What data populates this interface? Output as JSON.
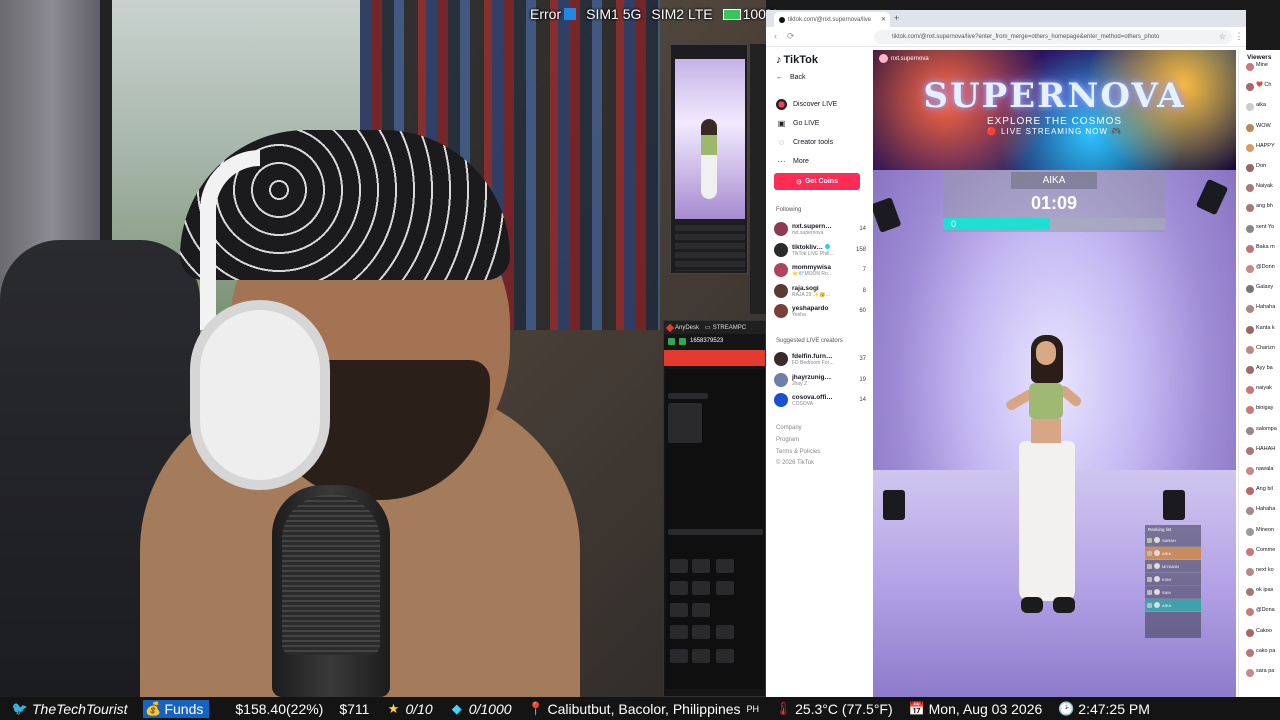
{
  "status_overlay": {
    "error": "Error",
    "sim1": "SIM1 5G",
    "sim2": "SIM2 LTE",
    "battery": "100%"
  },
  "anydesk": {
    "tab1": "AnyDesk",
    "tab2": "STREAMPC",
    "id": "1658379523"
  },
  "browser": {
    "tab_title": "tiktok.com/@nxt.supernova/live",
    "url": "tiktok.com/@nxt.supernova/live?enter_from_merge=others_homepage&enter_method=others_photo"
  },
  "tiktok": {
    "logo": "TikTok",
    "back": "Back",
    "nav": [
      {
        "label": "Discover LIVE",
        "icon": "live-disc-icon"
      },
      {
        "label": "Go LIVE",
        "icon": "camera-icon"
      },
      {
        "label": "Creator tools",
        "icon": "lightbulb-icon"
      },
      {
        "label": "More",
        "icon": "more-icon"
      }
    ],
    "get_coins": "Get Coins",
    "following_heading": "Following",
    "following": [
      {
        "name": "nxt.supern…",
        "sub": "nxt.supernova",
        "count": "14",
        "color": "#8e3b52"
      },
      {
        "name": "tiktokliv…",
        "sub": "TikTok LIVE Phili…",
        "count": "158",
        "color": "#2b2b2b"
      },
      {
        "name": "mommywisa",
        "sub": "⭐💎MOON Ro…",
        "count": "7",
        "color": "#b0445c"
      },
      {
        "name": "raja.sogi",
        "sub": "RAJA 29 ✨🥳…",
        "count": "8",
        "color": "#5a3a33"
      },
      {
        "name": "yeshapardo",
        "sub": "Yesha",
        "count": "60",
        "color": "#7a4036"
      }
    ],
    "suggested_heading": "Suggested LIVE creators",
    "suggested": [
      {
        "name": "fdelfin.furn…",
        "sub": "FD Bedroom For…",
        "count": "37",
        "color": "#3a2a2a"
      },
      {
        "name": "jhayrzunig…",
        "sub": "Jhay Z",
        "count": "19",
        "color": "#6f7fa8"
      },
      {
        "name": "cosova.offi…",
        "sub": "COSOVA",
        "count": "14",
        "color": "#1b4fd1"
      }
    ],
    "footer": [
      "Company",
      "Program",
      "Terms & Policies",
      "© 2026 TikTok"
    ]
  },
  "stream": {
    "host": "nxt.supernova",
    "brand": "SUPERNOVA",
    "tagline1": "EXPLORE THE COSMOS",
    "tagline2": "🔴 LIVE STREAMING NOW 🎮",
    "contestant": "AIKA",
    "timer": "01:09",
    "score": "0",
    "score_fraction": 0.48,
    "ranking_title": "Ranking list",
    "ranking": [
      "SARAH",
      "AIKA",
      "MIYAMIN",
      "KISH",
      "SAM",
      "AIKA"
    ]
  },
  "chat": {
    "header": "Viewers",
    "lines": [
      {
        "text": "Mine",
        "color": "#c77"
      },
      {
        "text": "❤️ Ch",
        "color": "#a66"
      },
      {
        "text": "aika",
        "color": "#ccc"
      },
      {
        "text": "WOW",
        "color": "#b85"
      },
      {
        "text": "HAPPY",
        "color": "#d96"
      },
      {
        "text": "Don",
        "color": "#966"
      },
      {
        "text": "Naiyak",
        "color": "#a77"
      },
      {
        "text": "ang bh",
        "color": "#a77"
      },
      {
        "text": "sent Yo",
        "color": "#888"
      },
      {
        "text": "Baka m",
        "color": "#b77"
      },
      {
        "text": "@Donn",
        "color": "#c88"
      },
      {
        "text": "Galaxy",
        "color": "#777"
      },
      {
        "text": "Hahaha",
        "color": "#a88"
      },
      {
        "text": "Kanta k",
        "color": "#966"
      },
      {
        "text": "Charizn",
        "color": "#b88"
      },
      {
        "text": "Ayy ba",
        "color": "#a66"
      },
      {
        "text": "naiyak",
        "color": "#c77"
      },
      {
        "text": "binigay",
        "color": "#c77"
      },
      {
        "text": "salompa",
        "color": "#988"
      },
      {
        "text": "HAHAH",
        "color": "#a77"
      },
      {
        "text": "nawala",
        "color": "#c88"
      },
      {
        "text": "Ang bil",
        "color": "#b66"
      },
      {
        "text": "Hahaha",
        "color": "#a88"
      },
      {
        "text": "Mineon",
        "color": "#999"
      },
      {
        "text": "Comme",
        "color": "#c77"
      },
      {
        "text": "next ko",
        "color": "#b88"
      },
      {
        "text": "ok ipas",
        "color": "#a77"
      },
      {
        "text": "@Dona",
        "color": "#c77"
      },
      {
        "text": "Cakoo",
        "color": "#a66"
      },
      {
        "text": "cako pa",
        "color": "#b77"
      },
      {
        "text": "sara pa",
        "color": "#c88"
      }
    ]
  },
  "ticker": {
    "handle": "TheTechTourist",
    "funds_label": "Funds",
    "funds_amount": "$158.40(22%)",
    "donation": "$711",
    "stars": "0/10",
    "gems": "0/1000",
    "location": "Calibutbut, Bacolor, Philippines",
    "country": "PH",
    "temperature": "25.3°C (77.5°F)",
    "date": "Mon, Aug 03 2026",
    "time": "2:47:25 PM"
  }
}
